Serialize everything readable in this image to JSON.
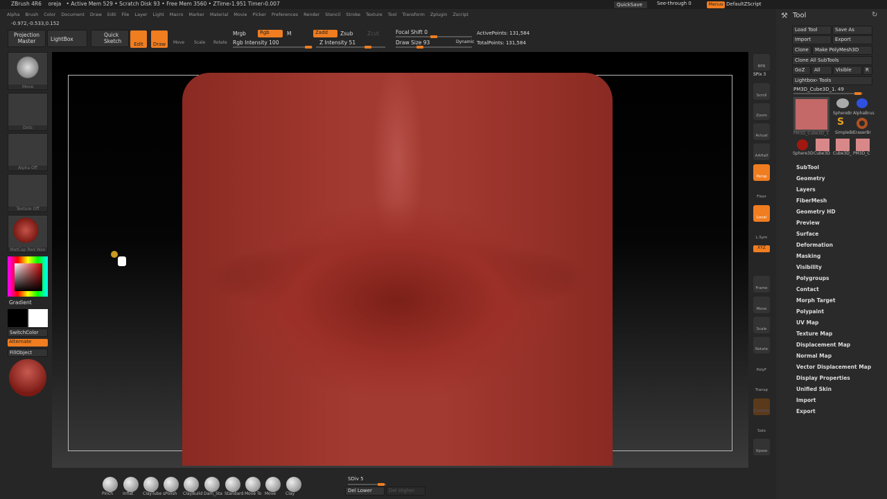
{
  "titlebar": {
    "app": "ZBrush 4R6",
    "doc": "oreja",
    "status": "• Active Mem 529 • Scratch Disk 93 • Free Mem 3560 • ZTime›1.951 Timer›0.007",
    "quicksave": "QuickSave",
    "seethrough": "See-through 0",
    "menus": "Menus",
    "script": "DefaultZScript"
  },
  "menu": [
    "Alpha",
    "Brush",
    "Color",
    "Document",
    "Draw",
    "Edit",
    "File",
    "Layer",
    "Light",
    "Macro",
    "Marker",
    "Material",
    "Movie",
    "Picker",
    "Preferences",
    "Render",
    "Stencil",
    "Stroke",
    "Texture",
    "Tool",
    "Transform",
    "Zplugin",
    "Zscript"
  ],
  "coords": "-0.972,-0.533,0.152",
  "toolbar": {
    "projection": "Projection Master",
    "lightbox": "LightBox",
    "quicksketch": "Quick Sketch",
    "edit": "Edit",
    "draw": "Draw",
    "move": "Move",
    "scale": "Scale",
    "rotate": "Rotate",
    "mrgb": "Mrgb",
    "rgb": "Rgb",
    "m": "M",
    "rgb_intensity": "Rgb Intensity 100",
    "zadd": "Zadd",
    "zsub": "Zsub",
    "zcut": "Zcut",
    "z_intensity": "Z Intensity 51",
    "focal_shift": "Focal Shift 0",
    "draw_size": "Draw Size 93",
    "dynamic": "Dynamic",
    "active_points": "ActivePoints: 131,584",
    "total_points": "TotalPoints: 131,584"
  },
  "left": {
    "brush": "Move",
    "stroke": "Dots",
    "alpha": "Alpha Off",
    "texture": "Texture Off",
    "material": "MatCap Red Wax",
    "gradient": "Gradient",
    "switchcolor": "SwitchColor",
    "alternate": "Alternate",
    "fillobject": "FillObject"
  },
  "right_tools": [
    "BPR",
    "SPix 3",
    "Scroll",
    "Zoom",
    "Actual",
    "AAHalf",
    "Persp",
    "Floor",
    "Local",
    "L.Sym",
    "XYZ",
    "Frame",
    "Move",
    "Scale",
    "Rotate",
    "PolyF",
    "Transp",
    "Dynamic",
    "Solo",
    "Xpose"
  ],
  "tool_panel": {
    "title": "Tool",
    "load": "Load Tool",
    "saveas": "Save As",
    "import": "Import",
    "export": "Export",
    "clone": "Clone",
    "make": "Make PolyMesh3D",
    "cloneall": "Clone All SubTools",
    "goz": "GoZ",
    "all": "All",
    "visible": "Visible",
    "r": "R",
    "lightbox_tools": "Lightbox› Tools",
    "current": "PM3D_Cube3D_1. 49",
    "thumbs": [
      "PM3D_Cube3D_1",
      "SphereBr",
      "AlphaBrus",
      "SimpleBr",
      "EraserBr",
      "Sphere3D",
      "Cube3D",
      "Cube3D_",
      "PM3D_C"
    ],
    "sections": [
      "SubTool",
      "Geometry",
      "Layers",
      "FiberMesh",
      "Geometry HD",
      "Preview",
      "Surface",
      "Deformation",
      "Masking",
      "Visibility",
      "Polygroups",
      "Contact",
      "Morph Target",
      "Polypaint",
      "UV Map",
      "Texture Map",
      "Displacement Map",
      "Normal Map",
      "Vector Displacement Map",
      "Display Properties",
      "Unified Skin",
      "Import",
      "Export"
    ]
  },
  "bottom": {
    "brushes": [
      "Pinch",
      "Inflat",
      "ClayTube",
      "sPolish",
      "ClayBuild",
      "Dam_Sta",
      "Standard",
      "Move To",
      "Move",
      "Clay"
    ],
    "sdiv": "SDiv 5",
    "del_lower": "Del Lower",
    "del_higher": "Del Higher"
  }
}
